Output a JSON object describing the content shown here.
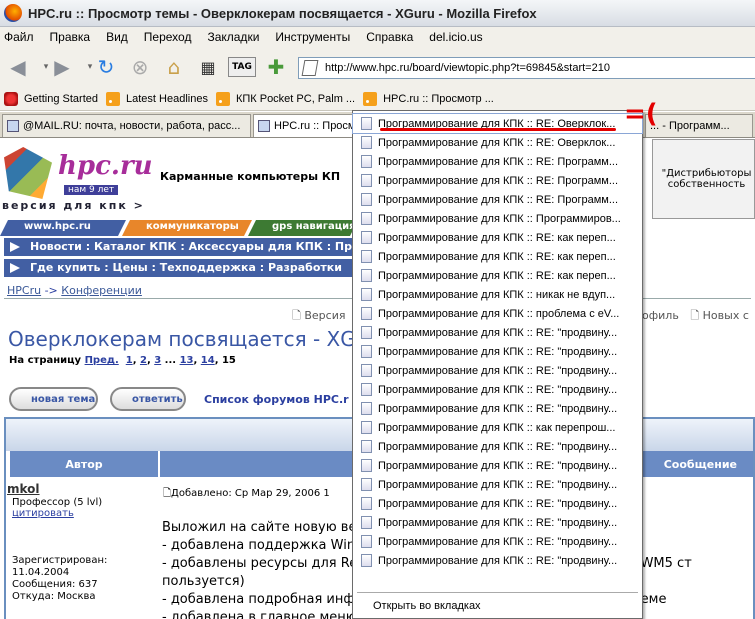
{
  "window": {
    "title": "HPC.ru :: Просмотр темы - Оверклокерам посвящается - XGuru - Mozilla Firefox"
  },
  "menu": [
    "Файл",
    "Правка",
    "Вид",
    "Переход",
    "Закладки",
    "Инструменты",
    "Справка",
    "del.icio.us"
  ],
  "toolbar": {
    "back": "back-icon",
    "forward": "forward-icon",
    "reload": "reload-icon",
    "stop": "stop-icon",
    "home": "home-icon",
    "tag_label": "TAG",
    "url": "http://www.hpc.ru/board/viewtopic.php?t=69845&start=210"
  },
  "bookmarks": [
    {
      "label": "Getting Started",
      "icon": "firefox-icon"
    },
    {
      "label": "Latest Headlines",
      "icon": "rss-icon"
    },
    {
      "label": "КПК Pocket PC, Palm ...",
      "icon": "rss-icon"
    },
    {
      "label": "HPC.ru :: Просмотр ...",
      "icon": "rss-icon"
    }
  ],
  "tabs": [
    {
      "label": "@MAIL.RU: почта, новости, работа, расс..."
    },
    {
      "label": "HPC.ru :: Просм"
    },
    {
      "label": "... - Программ..."
    }
  ],
  "site": {
    "logo_name": "hpc.ru",
    "logo_sub": "нам 9 лет",
    "slogan": "версия для кпк >",
    "tagline": "Карманные компьютеры КП",
    "ad_text": "\"Дистрибьюторы собственность",
    "strip": [
      "www.hpc.ru",
      "коммуникаторы",
      "gps навигация"
    ],
    "nav1": "Новости : Каталог КПК : Аксессуары для КПК : Пр",
    "nav2": "Где купить : Цены : Техподдержка : Разработки",
    "breadcrumb_home": "HPCru",
    "breadcrumb_sep": " -> ",
    "breadcrumb_section": "Конференции",
    "versia": "Версия",
    "profile": "офиль",
    "new_label": "Новых с",
    "topic_title": "Оверклокерам посвящается - XG",
    "pages_label": "На страницу",
    "pages_prev": "Пред.",
    "pages": [
      "1",
      "2",
      "3",
      "...",
      "13",
      "14",
      "15"
    ],
    "btn_new": "новая тема",
    "btn_reply": "ответить",
    "forums_link": "Список форумов HPC.r",
    "col_author": "Автор",
    "col_message": "Сообщение",
    "post_author": "mkol",
    "post_rank": "Профессор (5 lvl)",
    "post_cite": "цитировать",
    "post_reg": [
      "Зарегистрирован:",
      "11.04.2004",
      "Сообщения: 637",
      "Откуда: Москва"
    ],
    "post_date": "Добавлено: Ср Мар 29, 2006 1",
    "post_body": [
      "Выложил на сайте новую вер",
      "- добавлена поддержка Winc",
      "- добавлены ресурсы для Rea                                                   й версии WM5 ст",
      "пользуется)",
      "- добавлена подробная инфо                                                  ция о системе",
      "- добавлена в главное меню"
    ]
  },
  "dropdown": {
    "items": [
      "Программирование для КПК :: RE: Оверклок...",
      "Программирование для КПК :: RE: Оверклок...",
      "Программирование для КПК :: RE: Программ...",
      "Программирование для КПК :: RE: Программ...",
      "Программирование для КПК :: RE: Программ...",
      "Программирование для КПК :: Программиров...",
      "Программирование для КПК :: RE: как переп...",
      "Программирование для КПК :: RE: как переп...",
      "Программирование для КПК :: RE: как переп...",
      "Программирование для КПК :: никак не вдуп...",
      "Программирование для КПК :: проблема с eV...",
      "Программирование для КПК :: RE: \"продвину...",
      "Программирование для КПК :: RE: \"продвину...",
      "Программирование для КПК :: RE: \"продвину...",
      "Программирование для КПК :: RE: \"продвину...",
      "Программирование для КПК :: RE: \"продвину...",
      "Программирование для КПК :: как перепрош...",
      "Программирование для КПК :: RE: \"продвину...",
      "Программирование для КПК :: RE: \"продвину...",
      "Программирование для КПК :: RE: \"продвину...",
      "Программирование для КПК :: RE: \"продвину...",
      "Программирование для КПК :: RE: \"продвину...",
      "Программирование для КПК :: RE: \"продвину...",
      "Программирование для КПК :: RE: \"продвину..."
    ],
    "open_all": "Открыть во вкладках"
  },
  "annotation": "=("
}
